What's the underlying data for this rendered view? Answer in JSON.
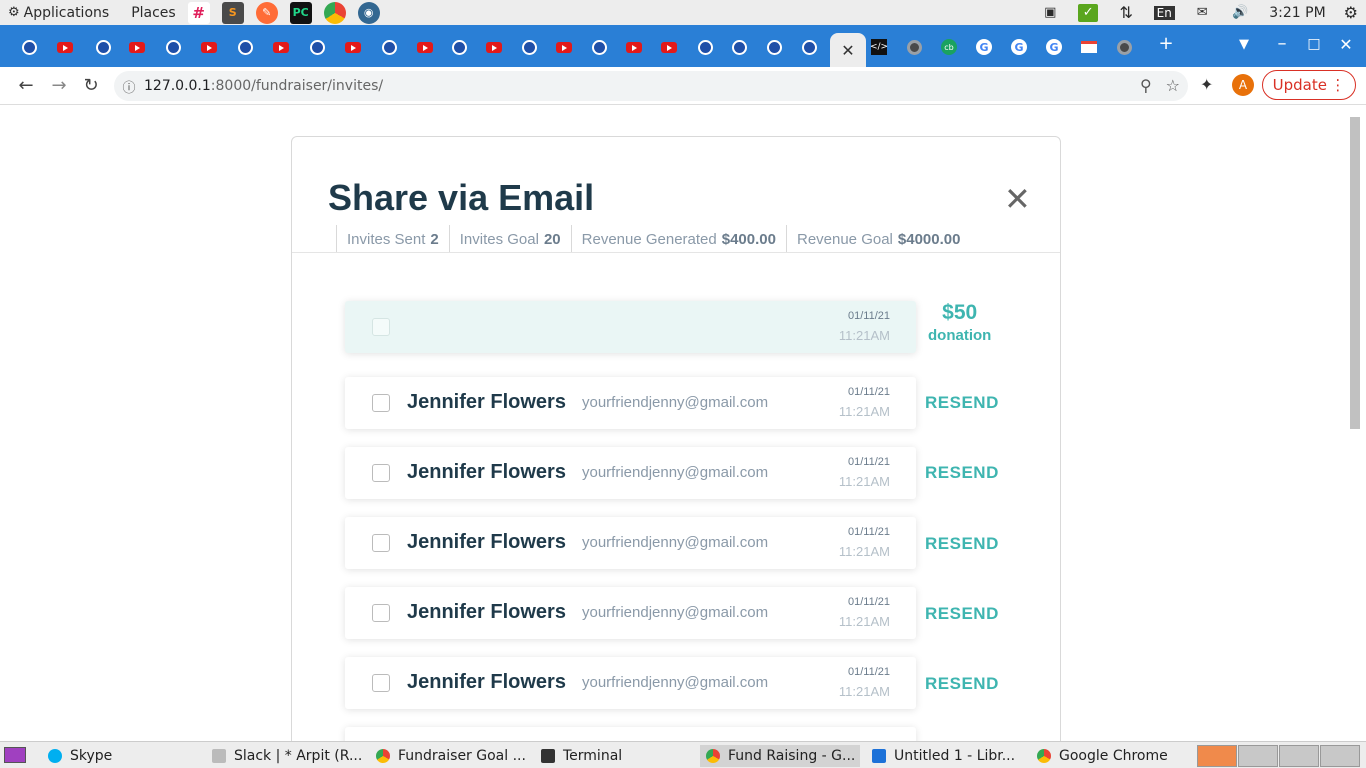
{
  "system_bar": {
    "applications": "Applications",
    "places": "Places",
    "keyboard_layout": "En",
    "clock": "3:21 PM"
  },
  "browser": {
    "url_host": "127.0.0.1",
    "url_path": ":8000/fundraiser/invites/",
    "update_label": "Update",
    "profile_initial": "A"
  },
  "modal": {
    "title": "Share via Email",
    "stats": [
      {
        "label": "Invites Sent",
        "value": "2"
      },
      {
        "label": "Invites Goal",
        "value": "20"
      },
      {
        "label": "Revenue Generated",
        "value": "$400.00"
      },
      {
        "label": "Revenue Goal",
        "value": "$4000.00"
      }
    ],
    "donation": {
      "amount": "$50",
      "label": "donation"
    },
    "first_row": {
      "date": "01/11/21",
      "time": "11:21AM"
    },
    "rows": [
      {
        "name": "Jennifer Flowers",
        "email": "yourfriendjenny@gmail.com",
        "date": "01/11/21",
        "time": "11:21AM",
        "action": "RESEND"
      },
      {
        "name": "Jennifer Flowers",
        "email": "yourfriendjenny@gmail.com",
        "date": "01/11/21",
        "time": "11:21AM",
        "action": "RESEND"
      },
      {
        "name": "Jennifer Flowers",
        "email": "yourfriendjenny@gmail.com",
        "date": "01/11/21",
        "time": "11:21AM",
        "action": "RESEND"
      },
      {
        "name": "Jennifer Flowers",
        "email": "yourfriendjenny@gmail.com",
        "date": "01/11/21",
        "time": "11:21AM",
        "action": "RESEND"
      },
      {
        "name": "Jennifer Flowers",
        "email": "yourfriendjenny@gmail.com",
        "date": "01/11/21",
        "time": "11:21AM",
        "action": "RESEND"
      }
    ]
  },
  "taskbar": [
    {
      "label": "Skype",
      "color": "#00aff0"
    },
    {
      "label": "Slack | * Arpit (R...",
      "color": "#777777"
    },
    {
      "label": "Fundraiser Goal ...",
      "color": "#4285f4"
    },
    {
      "label": "Terminal",
      "color": "#333333"
    },
    {
      "label": "Fund Raising - G...",
      "color": "#4285f4"
    },
    {
      "label": "Untitled 1 - Libr...",
      "color": "#1c71d8"
    },
    {
      "label": "Google Chrome",
      "color": "#4285f4"
    }
  ],
  "colors": {
    "accent": "#3eb5b0",
    "title": "#1f3a4a",
    "tab_strip": "#2a7fd6"
  }
}
